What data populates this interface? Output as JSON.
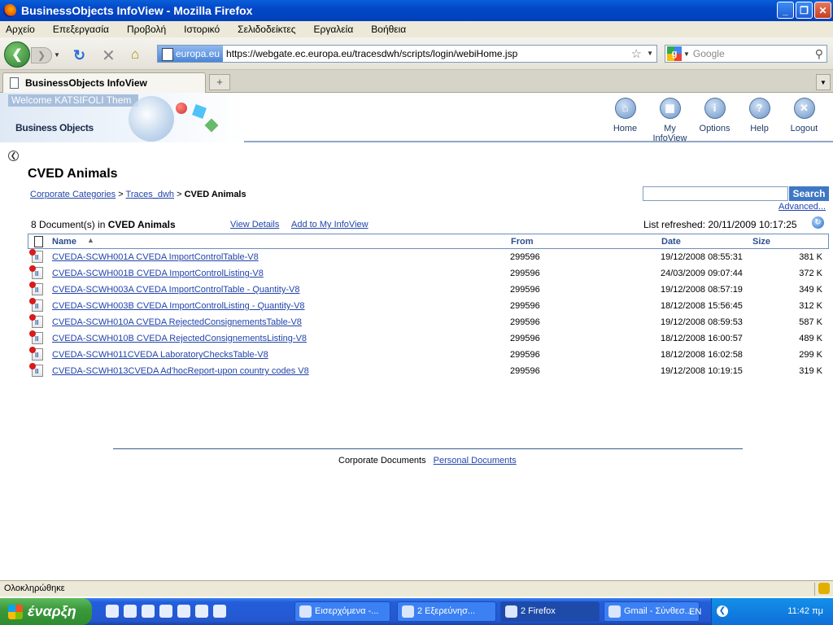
{
  "window": {
    "title": "BusinessObjects InfoView - Mozilla Firefox"
  },
  "menu": [
    "Αρχείο",
    "Επεξεργασία",
    "Προβολή",
    "Ιστορικό",
    "Σελιδοδείκτες",
    "Εργαλεία",
    "Βοήθεια"
  ],
  "navbar": {
    "site_identity": "europa.eu",
    "url": "https://webgate.ec.europa.eu/tracesdwh/scripts/login/webiHome.jsp",
    "search_placeholder": "Google"
  },
  "tab": {
    "title": "BusinessObjects InfoView",
    "new_tab": "+"
  },
  "app_header": {
    "welcome": "Welcome KATSIFOLI Them",
    "logo": "Business Objects",
    "nav": [
      {
        "label": "Home",
        "icon": "home-icon",
        "glyph": "⌂"
      },
      {
        "label": "My InfoView",
        "icon": "my-infoview-icon",
        "glyph": "▦"
      },
      {
        "label": "Options",
        "icon": "options-icon",
        "glyph": "i"
      },
      {
        "label": "Help",
        "icon": "help-icon",
        "glyph": "?"
      },
      {
        "label": "Logout",
        "icon": "logout-icon",
        "glyph": "✕"
      }
    ]
  },
  "page": {
    "title": "CVED Animals",
    "breadcrumb": {
      "root": "Corporate Categories",
      "sep1": ">",
      "mid": "Traces_dwh",
      "sep2": ">",
      "current": "CVED Animals"
    },
    "search_button": "Search",
    "advanced_link": "Advanced...",
    "count_prefix": "8 Document(s) in",
    "count_folder": "CVED Animals",
    "view_details": "View Details",
    "add_to_infoview": "Add to My InfoView",
    "list_refreshed": "List refreshed: 20/11/2009 10:17:25"
  },
  "table": {
    "columns": {
      "name": "Name",
      "from": "From",
      "date": "Date",
      "size": "Size"
    },
    "rows": [
      {
        "name": "CVEDA-SCWH001A CVEDA ImportControlTable-V8",
        "from": "299596",
        "date": "19/12/2008 08:55:31",
        "size": "381 K"
      },
      {
        "name": "CVEDA-SCWH001B CVEDA ImportControlListing-V8",
        "from": "299596",
        "date": "24/03/2009 09:07:44",
        "size": "372 K"
      },
      {
        "name": "CVEDA-SCWH003A CVEDA ImportControlTable - Quantity-V8",
        "from": "299596",
        "date": "19/12/2008 08:57:19",
        "size": "349 K"
      },
      {
        "name": "CVEDA-SCWH003B CVEDA ImportControlListing - Quantity-V8",
        "from": "299596",
        "date": "18/12/2008 15:56:45",
        "size": "312 K"
      },
      {
        "name": "CVEDA-SCWH010A CVEDA RejectedConsignementsTable-V8",
        "from": "299596",
        "date": "19/12/2008 08:59:53",
        "size": "587 K"
      },
      {
        "name": "CVEDA-SCWH010B CVEDA RejectedConsignementsListing-V8",
        "from": "299596",
        "date": "18/12/2008 16:00:57",
        "size": "489 K"
      },
      {
        "name": "CVEDA-SCWH011CVEDA LaboratoryChecksTable-V8",
        "from": "299596",
        "date": "18/12/2008 16:02:58",
        "size": "299 K"
      },
      {
        "name": "CVEDA-SCWH013CVEDA Ad'hocReport-upon country codes V8",
        "from": "299596",
        "date": "19/12/2008 10:19:15",
        "size": "319 K"
      }
    ]
  },
  "footer": {
    "corporate": "Corporate Documents",
    "personal": "Personal Documents"
  },
  "status": {
    "text": "Ολοκληρώθηκε"
  },
  "taskbar": {
    "start": "έναρξη",
    "items": [
      {
        "label": "Εισερχόμενα -..."
      },
      {
        "label": "2 Εξερεύνησ..."
      },
      {
        "label": "2 Firefox"
      },
      {
        "label": "Gmail - Σύνθεσ..."
      }
    ],
    "lang": "EN",
    "clock": "11:42 πμ"
  }
}
